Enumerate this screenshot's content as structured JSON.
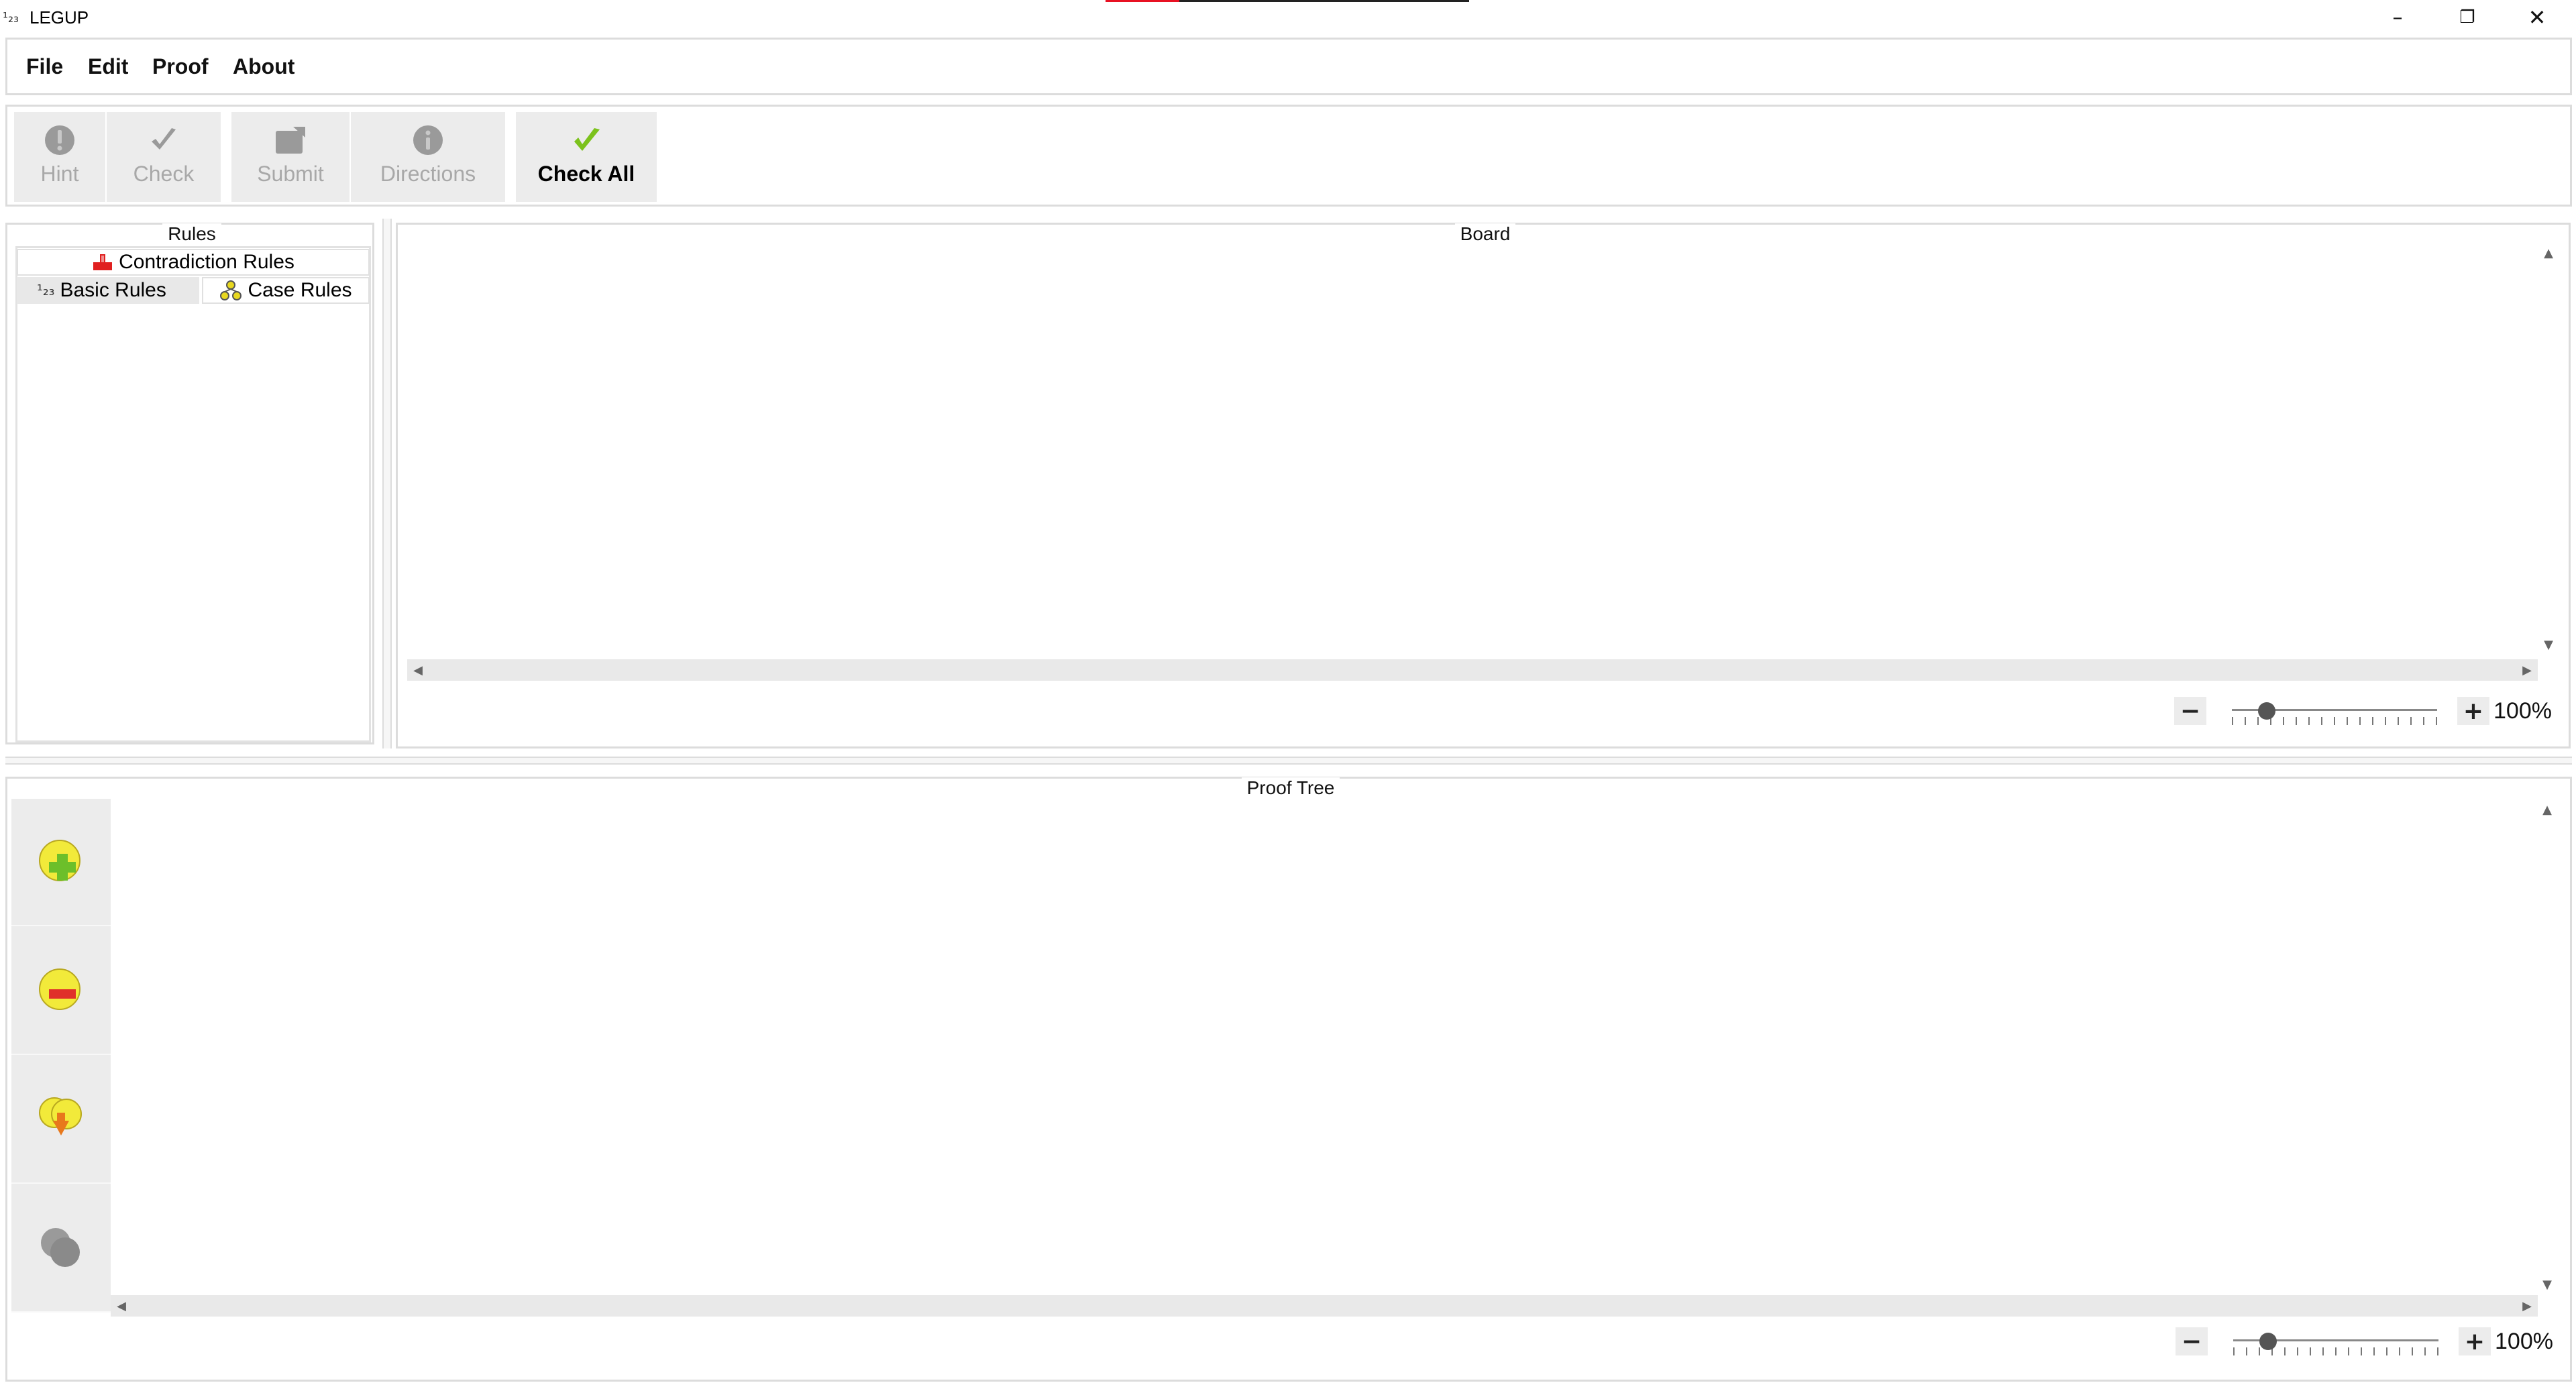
{
  "window": {
    "title": "LEGUP",
    "icon": "legup-app-icon",
    "controls": {
      "minimize": "–",
      "maximize": "❐",
      "close": "✕"
    }
  },
  "menu": {
    "items": [
      "File",
      "Edit",
      "Proof",
      "About"
    ]
  },
  "toolbar": {
    "hint": {
      "label": "Hint",
      "icon": "hint-icon",
      "enabled": false
    },
    "check": {
      "label": "Check",
      "icon": "check-icon",
      "enabled": false
    },
    "submit": {
      "label": "Submit",
      "icon": "submit-icon",
      "enabled": false
    },
    "directions": {
      "label": "Directions",
      "icon": "info-icon",
      "enabled": false
    },
    "check_all": {
      "label": "Check All",
      "icon": "green-check-icon",
      "enabled": true
    }
  },
  "rules": {
    "title": "Rules",
    "tabs": {
      "contradiction": "Contradiction Rules",
      "basic": "Basic Rules",
      "case": "Case Rules"
    },
    "selected_tab": "Basic Rules"
  },
  "board": {
    "title": "Board",
    "zoom": {
      "minus": "−",
      "plus": "+",
      "value": "100%",
      "level_fraction": 0.17
    }
  },
  "proof_tree": {
    "title": "Proof Tree",
    "tools": [
      "add-node-icon",
      "remove-node-icon",
      "merge-node-icon",
      "collapse-node-icon"
    ],
    "zoom": {
      "minus": "−",
      "plus": "+",
      "value": "100%",
      "level_fraction": 0.17
    }
  },
  "colors": {
    "border": "#dcdcdc",
    "toolbar_button_bg": "#ececec",
    "disabled_text": "#a8a8a8",
    "check_green": "#7cc21c",
    "icon_yellow": "#f2ea3a"
  }
}
